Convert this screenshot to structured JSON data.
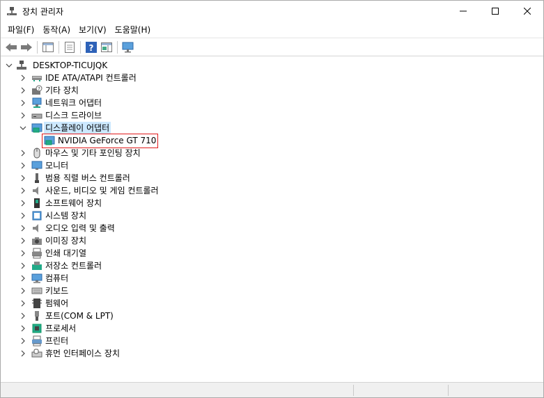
{
  "window": {
    "title": "장치 관리자"
  },
  "menu": [
    {
      "label": "파일(F)"
    },
    {
      "label": "동작(A)"
    },
    {
      "label": "보기(V)"
    },
    {
      "label": "도움말(H)"
    }
  ],
  "tree": {
    "root": "DESKTOP-TICUJQK",
    "categories": [
      {
        "label": "IDE ATA/ATAPI 컨트롤러",
        "icon": "ide-controller-icon",
        "expanded": false
      },
      {
        "label": "기타 장치",
        "icon": "unknown-device-icon",
        "expanded": false
      },
      {
        "label": "네트워크 어댑터",
        "icon": "network-adapter-icon",
        "expanded": false
      },
      {
        "label": "디스크 드라이브",
        "icon": "disk-drive-icon",
        "expanded": false
      },
      {
        "label": "디스플레이 어댑터",
        "icon": "display-adapter-icon",
        "expanded": true,
        "children": [
          {
            "label": "NVIDIA GeForce GT 710",
            "icon": "display-adapter-icon"
          }
        ]
      },
      {
        "label": "마우스 및 기타 포인팅 장치",
        "icon": "mouse-icon",
        "expanded": false
      },
      {
        "label": "모니터",
        "icon": "monitor-icon",
        "expanded": false
      },
      {
        "label": "범용 직렬 버스 컨트롤러",
        "icon": "usb-icon",
        "expanded": false
      },
      {
        "label": "사운드, 비디오 및 게임 컨트롤러",
        "icon": "speaker-icon",
        "expanded": false
      },
      {
        "label": "소프트웨어 장치",
        "icon": "software-device-icon",
        "expanded": false
      },
      {
        "label": "시스템 장치",
        "icon": "system-device-icon",
        "expanded": false
      },
      {
        "label": "오디오 입력 및 출력",
        "icon": "audio-icon",
        "expanded": false
      },
      {
        "label": "이미징 장치",
        "icon": "camera-icon",
        "expanded": false
      },
      {
        "label": "인쇄 대기열",
        "icon": "printer-queue-icon",
        "expanded": false
      },
      {
        "label": "저장소 컨트롤러",
        "icon": "storage-controller-icon",
        "expanded": false
      },
      {
        "label": "컴퓨터",
        "icon": "computer-icon",
        "expanded": false
      },
      {
        "label": "키보드",
        "icon": "keyboard-icon",
        "expanded": false
      },
      {
        "label": "펌웨어",
        "icon": "firmware-icon",
        "expanded": false
      },
      {
        "label": "포트(COM & LPT)",
        "icon": "port-icon",
        "expanded": false
      },
      {
        "label": "프로세서",
        "icon": "processor-icon",
        "expanded": false
      },
      {
        "label": "프린터",
        "icon": "printer-icon",
        "expanded": false
      },
      {
        "label": "휴먼 인터페이스 장치",
        "icon": "hid-icon",
        "expanded": false
      }
    ]
  },
  "colors": {
    "selection": "#cce8ff",
    "highlight_border": "#e0191a"
  }
}
